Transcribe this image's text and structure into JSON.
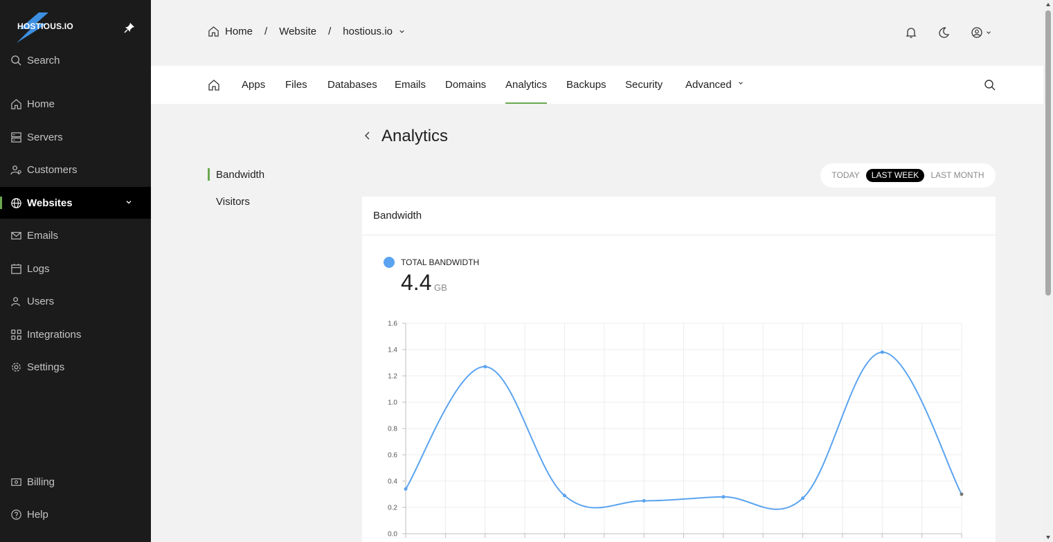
{
  "brand": {
    "name": "HOSTIOUS.IO"
  },
  "sidebar": {
    "items": [
      {
        "label": "Search",
        "icon": "search-icon"
      },
      {
        "label": "Home",
        "icon": "home-icon"
      },
      {
        "label": "Servers",
        "icon": "server-icon"
      },
      {
        "label": "Customers",
        "icon": "customers-icon"
      },
      {
        "label": "Websites",
        "icon": "globe-icon",
        "active": true
      },
      {
        "label": "Emails",
        "icon": "mail-icon"
      },
      {
        "label": "Logs",
        "icon": "calendar-icon"
      },
      {
        "label": "Users",
        "icon": "users-icon"
      },
      {
        "label": "Integrations",
        "icon": "integrations-icon"
      },
      {
        "label": "Settings",
        "icon": "gear-icon"
      },
      {
        "label": "Billing",
        "icon": "billing-icon"
      },
      {
        "label": "Help",
        "icon": "help-icon"
      }
    ]
  },
  "breadcrumb": {
    "home": "Home",
    "section": "Website",
    "site": "hostious.io"
  },
  "tabs": [
    "Apps",
    "Files",
    "Databases",
    "Emails",
    "Domains",
    "Analytics",
    "Backups",
    "Security",
    "Advanced"
  ],
  "active_tab": "Analytics",
  "page": {
    "title": "Analytics"
  },
  "subnav": [
    "Bandwidth",
    "Visitors"
  ],
  "range": {
    "options": [
      "TODAY",
      "LAST WEEK",
      "LAST MONTH"
    ],
    "selected": "LAST WEEK"
  },
  "card": {
    "title": "Bandwidth",
    "legend": "TOTAL BANDWIDTH",
    "total_value": "4.4",
    "total_unit": "GB"
  },
  "colors": {
    "accent": "#6aa84f",
    "series": "#5aa3f0",
    "sidebar_bg": "#1b1b1b"
  },
  "chart_data": {
    "type": "line",
    "x": [
      0,
      1,
      2,
      3,
      4,
      5,
      6,
      7,
      8,
      9,
      10,
      11,
      12,
      13,
      14
    ],
    "points": [
      {
        "x": 0,
        "y": 0.34
      },
      {
        "x": 2,
        "y": 1.27
      },
      {
        "x": 4,
        "y": 0.29
      },
      {
        "x": 6,
        "y": 0.25
      },
      {
        "x": 8,
        "y": 0.28
      },
      {
        "x": 10,
        "y": 0.27
      },
      {
        "x": 12,
        "y": 1.38
      },
      {
        "x": 14,
        "y": 0.3
      }
    ],
    "yticks": [
      "0.0",
      "0.2",
      "0.4",
      "0.6",
      "0.8",
      "1.0",
      "1.2",
      "1.4",
      "1.6"
    ],
    "ylim": [
      0,
      1.6
    ],
    "xlim": [
      0,
      14
    ],
    "grid": true,
    "series_name": "TOTAL BANDWIDTH"
  }
}
